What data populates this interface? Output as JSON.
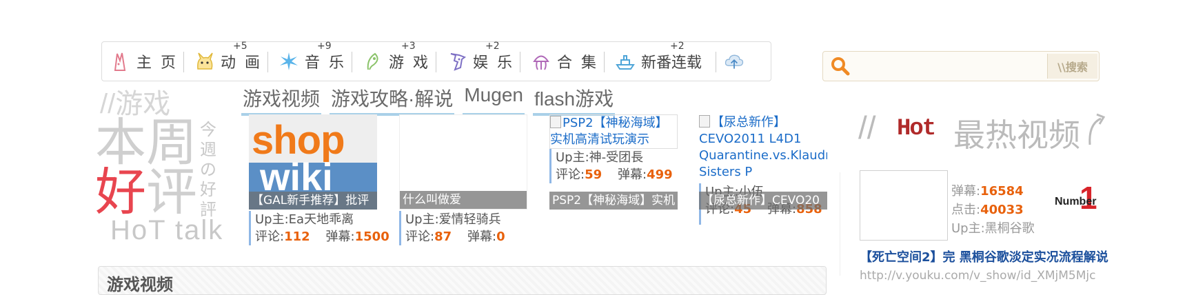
{
  "nav": {
    "items": [
      {
        "label": "主 页",
        "icon": "bunny-icon",
        "badge": ""
      },
      {
        "label": "动 画",
        "icon": "pikachu-icon",
        "badge": "+5"
      },
      {
        "label": "音 乐",
        "icon": "sparkle-icon",
        "badge": "+9"
      },
      {
        "label": "游 戏",
        "icon": "leaf-icon",
        "badge": "+3"
      },
      {
        "label": "娱 乐",
        "icon": "robot-icon",
        "badge": "+2"
      },
      {
        "label": "合 集",
        "icon": "jellyfish-icon",
        "badge": ""
      },
      {
        "label": "新番连载",
        "icon": "ship-icon",
        "badge": "+2"
      }
    ],
    "extra_icon": "cloud-upload-icon"
  },
  "search": {
    "placeholder": "",
    "button_label": "\\\\搜索"
  },
  "section": {
    "title": "//游戏",
    "subtabs": [
      "游戏视频",
      "游戏攻略·解说",
      "Mugen",
      "flash游戏"
    ]
  },
  "weekly": {
    "line1": "本周",
    "line2": "好评",
    "vertical": "今週の好評",
    "footer": "HoT talk"
  },
  "cards": [
    {
      "caption": "【GAL新手推荐】批评",
      "thumb_text1": "shop",
      "thumb_text2": "wiki",
      "up_label": "Up主:",
      "up": "Ea天地乖离",
      "comment_label": "评论:",
      "comments": "112",
      "danmaku_label": "弹幕:",
      "danmaku": "1500"
    },
    {
      "caption": "什么叫做爱",
      "up_label": "Up主:",
      "up": "爱情轻骑兵",
      "comment_label": "评论:",
      "comments": "87",
      "danmaku_label": "弹幕:",
      "danmaku": "0"
    },
    {
      "alt": "PSP2【神秘海域】实机高清试玩演示",
      "caption": "PSP2【神秘海域】实机",
      "up_label": "Up主:",
      "up": "神-受团長",
      "comment_label": "评论:",
      "comments": "59",
      "danmaku_label": "弹幕:",
      "danmaku": "499"
    },
    {
      "alt": "【尿总新作】CEVO2011 L4D1 Quarantine.vs.Klaudn Sisters P",
      "caption": "【尿总新作】CEVO20",
      "up_label": "Up主:",
      "up": "小伍",
      "comment_label": "评论:",
      "comments": "45",
      "danmaku_label": "弹幕:",
      "danmaku": "858"
    }
  ],
  "hot": {
    "title_prefix": "//",
    "title_hot": "Hot",
    "title_main": "最热视频",
    "danmaku_label": "弹幕:",
    "danmaku": "16584",
    "click_label": "点击:",
    "clicks": "40033",
    "up_label": "Up主:",
    "up": "黑桐谷歌",
    "rank_label": "Number",
    "rank": "1",
    "video_title": "【死亡空间2】完 黑桐谷歌淡定实况流程解说",
    "url": "http://v.youku.com/v_show/id_XMjM5Mjc"
  },
  "bottom": {
    "title": "游戏视频"
  },
  "colors": {
    "accent": "#e8610c",
    "link": "#1b6cc8",
    "tab_underline": "#a9d0e8",
    "weekly_red": "#e8454f"
  }
}
